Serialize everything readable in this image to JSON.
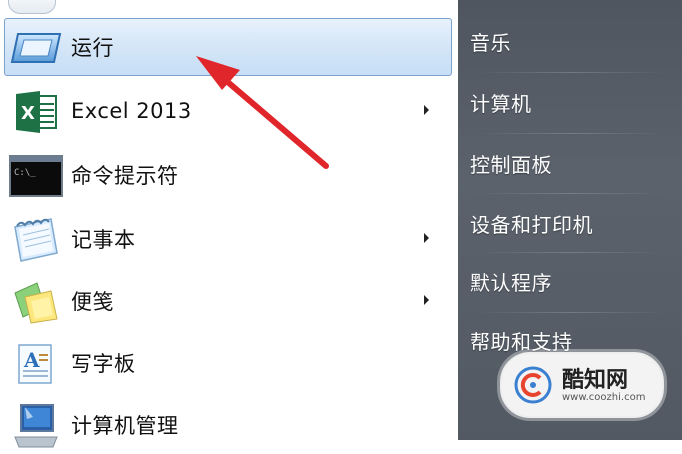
{
  "left_menu": {
    "items": [
      {
        "label": "运行",
        "icon": "run-icon",
        "has_submenu": false,
        "selected": true
      },
      {
        "label": "Excel 2013",
        "icon": "excel-icon",
        "has_submenu": true,
        "selected": false
      },
      {
        "label": "命令提示符",
        "icon": "command-prompt-icon",
        "has_submenu": false,
        "selected": false
      },
      {
        "label": "记事本",
        "icon": "notepad-icon",
        "has_submenu": true,
        "selected": false
      },
      {
        "label": "便笺",
        "icon": "sticky-notes-icon",
        "has_submenu": true,
        "selected": false
      },
      {
        "label": "写字板",
        "icon": "wordpad-icon",
        "has_submenu": false,
        "selected": false
      },
      {
        "label": "计算机管理",
        "icon": "computer-management-icon",
        "has_submenu": false,
        "selected": false
      }
    ]
  },
  "right_menu": {
    "items": [
      {
        "label": "音乐"
      },
      {
        "label": "计算机"
      },
      {
        "label": "控制面板"
      },
      {
        "label": "设备和打印机"
      },
      {
        "label": "默认程序"
      },
      {
        "label": "帮助和支持"
      }
    ]
  },
  "watermark": {
    "title": "酷知网",
    "url": "www.coozhi.com"
  },
  "colors": {
    "selection": "#cfe3f7",
    "right_pane": "#555c66",
    "annotation_arrow": "#e0262b",
    "excel_green": "#1e7145"
  }
}
